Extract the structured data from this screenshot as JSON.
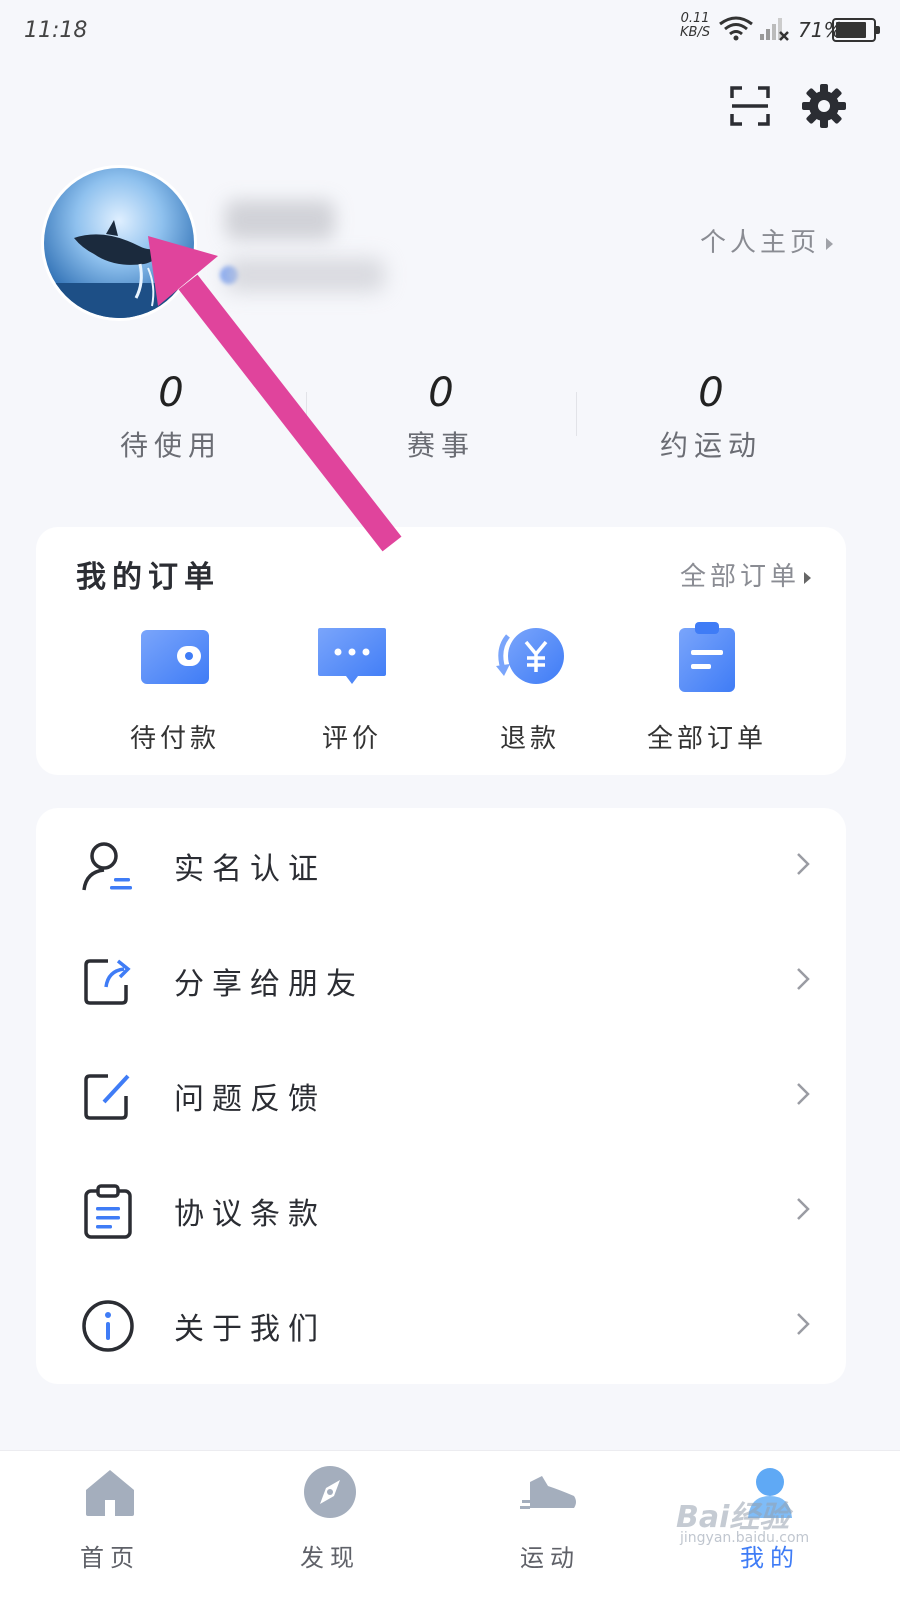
{
  "status_bar": {
    "time": "11:18",
    "speed_value": "0.11",
    "speed_unit": "KB/S",
    "battery": "71%"
  },
  "profile": {
    "home_link": "个人主页"
  },
  "stats": [
    {
      "value": "0",
      "label": "待使用"
    },
    {
      "value": "0",
      "label": "赛事"
    },
    {
      "value": "0",
      "label": "约运动"
    }
  ],
  "orders": {
    "title": "我的订单",
    "all_link": "全部订单",
    "items": [
      {
        "label": "待付款",
        "icon": "wallet-icon"
      },
      {
        "label": "评价",
        "icon": "comment-icon"
      },
      {
        "label": "退款",
        "icon": "refund-icon"
      },
      {
        "label": "全部订单",
        "icon": "clipboard-icon"
      }
    ]
  },
  "menu": [
    {
      "label": "实名认证",
      "icon": "user-verify-icon"
    },
    {
      "label": "分享给朋友",
      "icon": "share-icon"
    },
    {
      "label": "问题反馈",
      "icon": "feedback-edit-icon"
    },
    {
      "label": "协议条款",
      "icon": "agreement-clipboard-icon"
    },
    {
      "label": "关于我们",
      "icon": "info-icon"
    }
  ],
  "bottom_nav": [
    {
      "label": "首页",
      "icon": "home-icon"
    },
    {
      "label": "发现",
      "icon": "compass-icon"
    },
    {
      "label": "运动",
      "icon": "sneaker-icon"
    },
    {
      "label": "我的",
      "icon": "profile-icon",
      "active": true
    }
  ],
  "watermark": {
    "text": "Bai经验",
    "sub": "jingyan.baidu.com"
  },
  "colors": {
    "accent": "#3f7cf6",
    "accent_light": "#7aa5fb",
    "annotation_arrow": "#e0449c",
    "background": "#f6f7fb"
  }
}
